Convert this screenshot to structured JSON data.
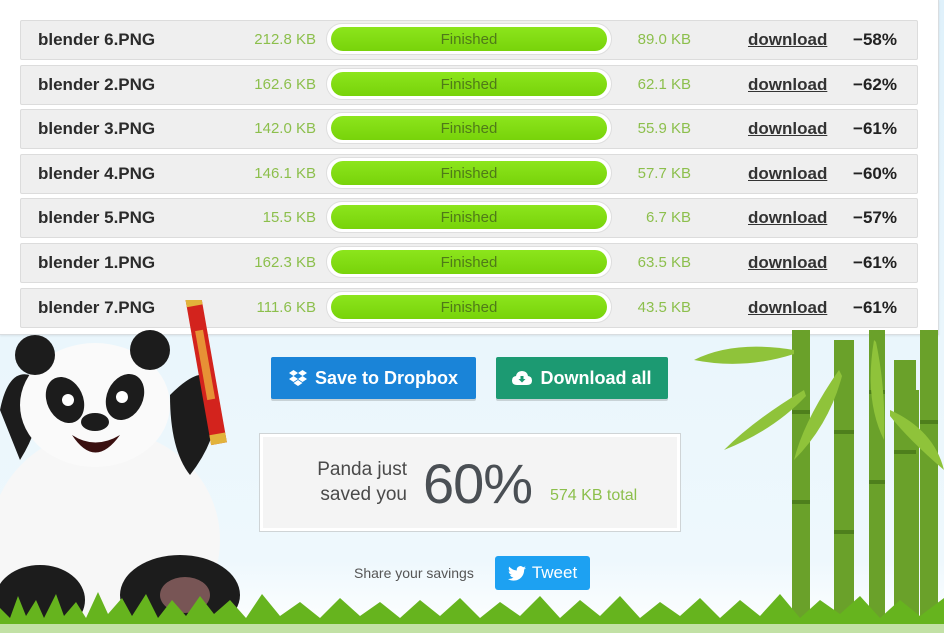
{
  "files": [
    {
      "name": "blender 6.PNG",
      "orig_size": "212.8 KB",
      "status": "Finished",
      "new_size": "89.0 KB",
      "link": "download",
      "saving": "−58%"
    },
    {
      "name": "blender 2.PNG",
      "orig_size": "162.6 KB",
      "status": "Finished",
      "new_size": "62.1 KB",
      "link": "download",
      "saving": "−62%"
    },
    {
      "name": "blender 3.PNG",
      "orig_size": "142.0 KB",
      "status": "Finished",
      "new_size": "55.9 KB",
      "link": "download",
      "saving": "−61%"
    },
    {
      "name": "blender 4.PNG",
      "orig_size": "146.1 KB",
      "status": "Finished",
      "new_size": "57.7 KB",
      "link": "download",
      "saving": "−60%"
    },
    {
      "name": "blender 5.PNG",
      "orig_size": "15.5 KB",
      "status": "Finished",
      "new_size": "6.7 KB",
      "link": "download",
      "saving": "−57%"
    },
    {
      "name": "blender 1.PNG",
      "orig_size": "162.3 KB",
      "status": "Finished",
      "new_size": "63.5 KB",
      "link": "download",
      "saving": "−61%"
    },
    {
      "name": "blender 7.PNG",
      "orig_size": "111.6 KB",
      "status": "Finished",
      "new_size": "43.5 KB",
      "link": "download",
      "saving": "−61%"
    }
  ],
  "progress": 1.0,
  "actions": {
    "dropbox_label": "Save to Dropbox",
    "download_all_label": "Download all"
  },
  "savings": {
    "lead": "Panda just saved you",
    "percent": "60%",
    "total": "574 KB total"
  },
  "share": {
    "label": "Share your savings",
    "tweet_label": "Tweet"
  },
  "colors": {
    "progress_fill": "#7fdb12",
    "size_text": "#8cbf4c",
    "dropbox_button": "#1a84d8",
    "download_all_button": "#1c9a72",
    "tweet_button": "#1da1f2"
  },
  "icons": [
    "dropbox-icon",
    "cloud-download-icon",
    "twitter-bird-icon",
    "panda-mascot",
    "bamboo"
  ]
}
